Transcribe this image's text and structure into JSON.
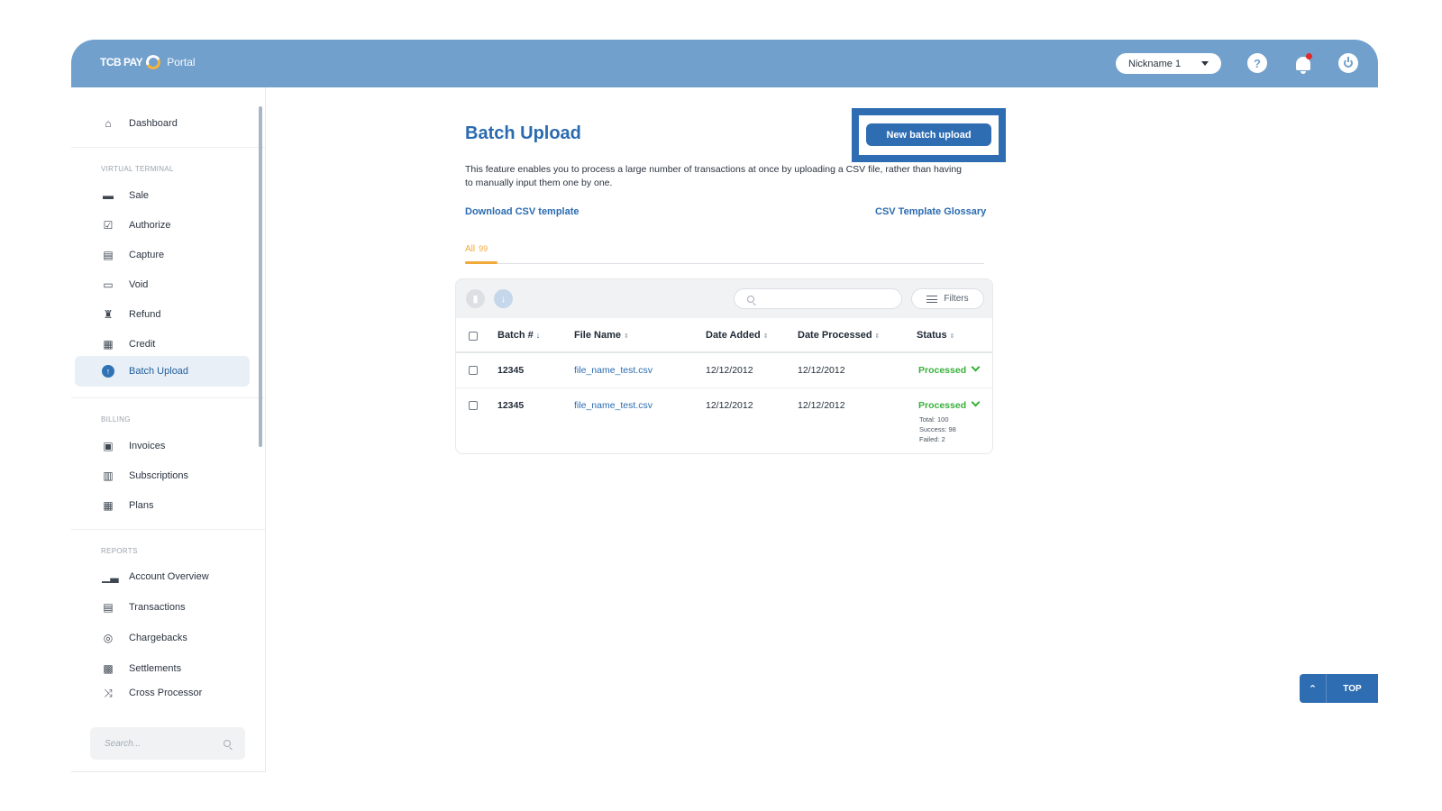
{
  "header": {
    "brand": "TCB PAY",
    "portal_label": "Portal",
    "account_selector": "Nickname 1",
    "help_glyph": "?"
  },
  "sidebar": {
    "dashboard": "Dashboard",
    "sections": {
      "virtual_terminal": "VIRTUAL TERMINAL",
      "billing": "BILLING",
      "reports": "REPORTS"
    },
    "virtual_terminal_items": [
      "Sale",
      "Authorize",
      "Capture",
      "Void",
      "Refund",
      "Credit",
      "Batch Upload"
    ],
    "billing_items": [
      "Invoices",
      "Subscriptions",
      "Plans"
    ],
    "reports_items": [
      "Account Overview",
      "Transactions",
      "Chargebacks",
      "Settlements",
      "Cross Processor"
    ],
    "active_item": "Batch Upload",
    "search_placeholder": "Search..."
  },
  "main": {
    "title": "Batch Upload",
    "new_batch_button": "New batch upload",
    "description": "This feature enables you to process a large number of transactions at once by uploading a CSV file, rather than having to manually input them one by one.",
    "download_link": "Download CSV template",
    "glossary_link": "CSV Template Glossary",
    "tab": {
      "label": "All",
      "count": "99"
    },
    "toolbar": {
      "filters_label": "Filters"
    },
    "table": {
      "columns": [
        "Batch #",
        "File Name",
        "Date Added",
        "Date Processed",
        "Status"
      ],
      "rows": [
        {
          "batch": "12345",
          "file": "file_name_test.csv",
          "date_added": "12/12/2012",
          "date_processed": "12/12/2012",
          "status": "Processed",
          "details": []
        },
        {
          "batch": "12345",
          "file": "file_name_test.csv",
          "date_added": "12/12/2012",
          "date_processed": "12/12/2012",
          "status": "Processed",
          "details": [
            "Total: 100",
            "Success: 98",
            "Failed: 2"
          ]
        }
      ]
    }
  },
  "top_button": {
    "label": "TOP"
  },
  "colors": {
    "header_bg": "#72a0cc",
    "primary": "#2f6db3",
    "accent_tab": "#f1a93a",
    "status_green": "#38b03a"
  }
}
